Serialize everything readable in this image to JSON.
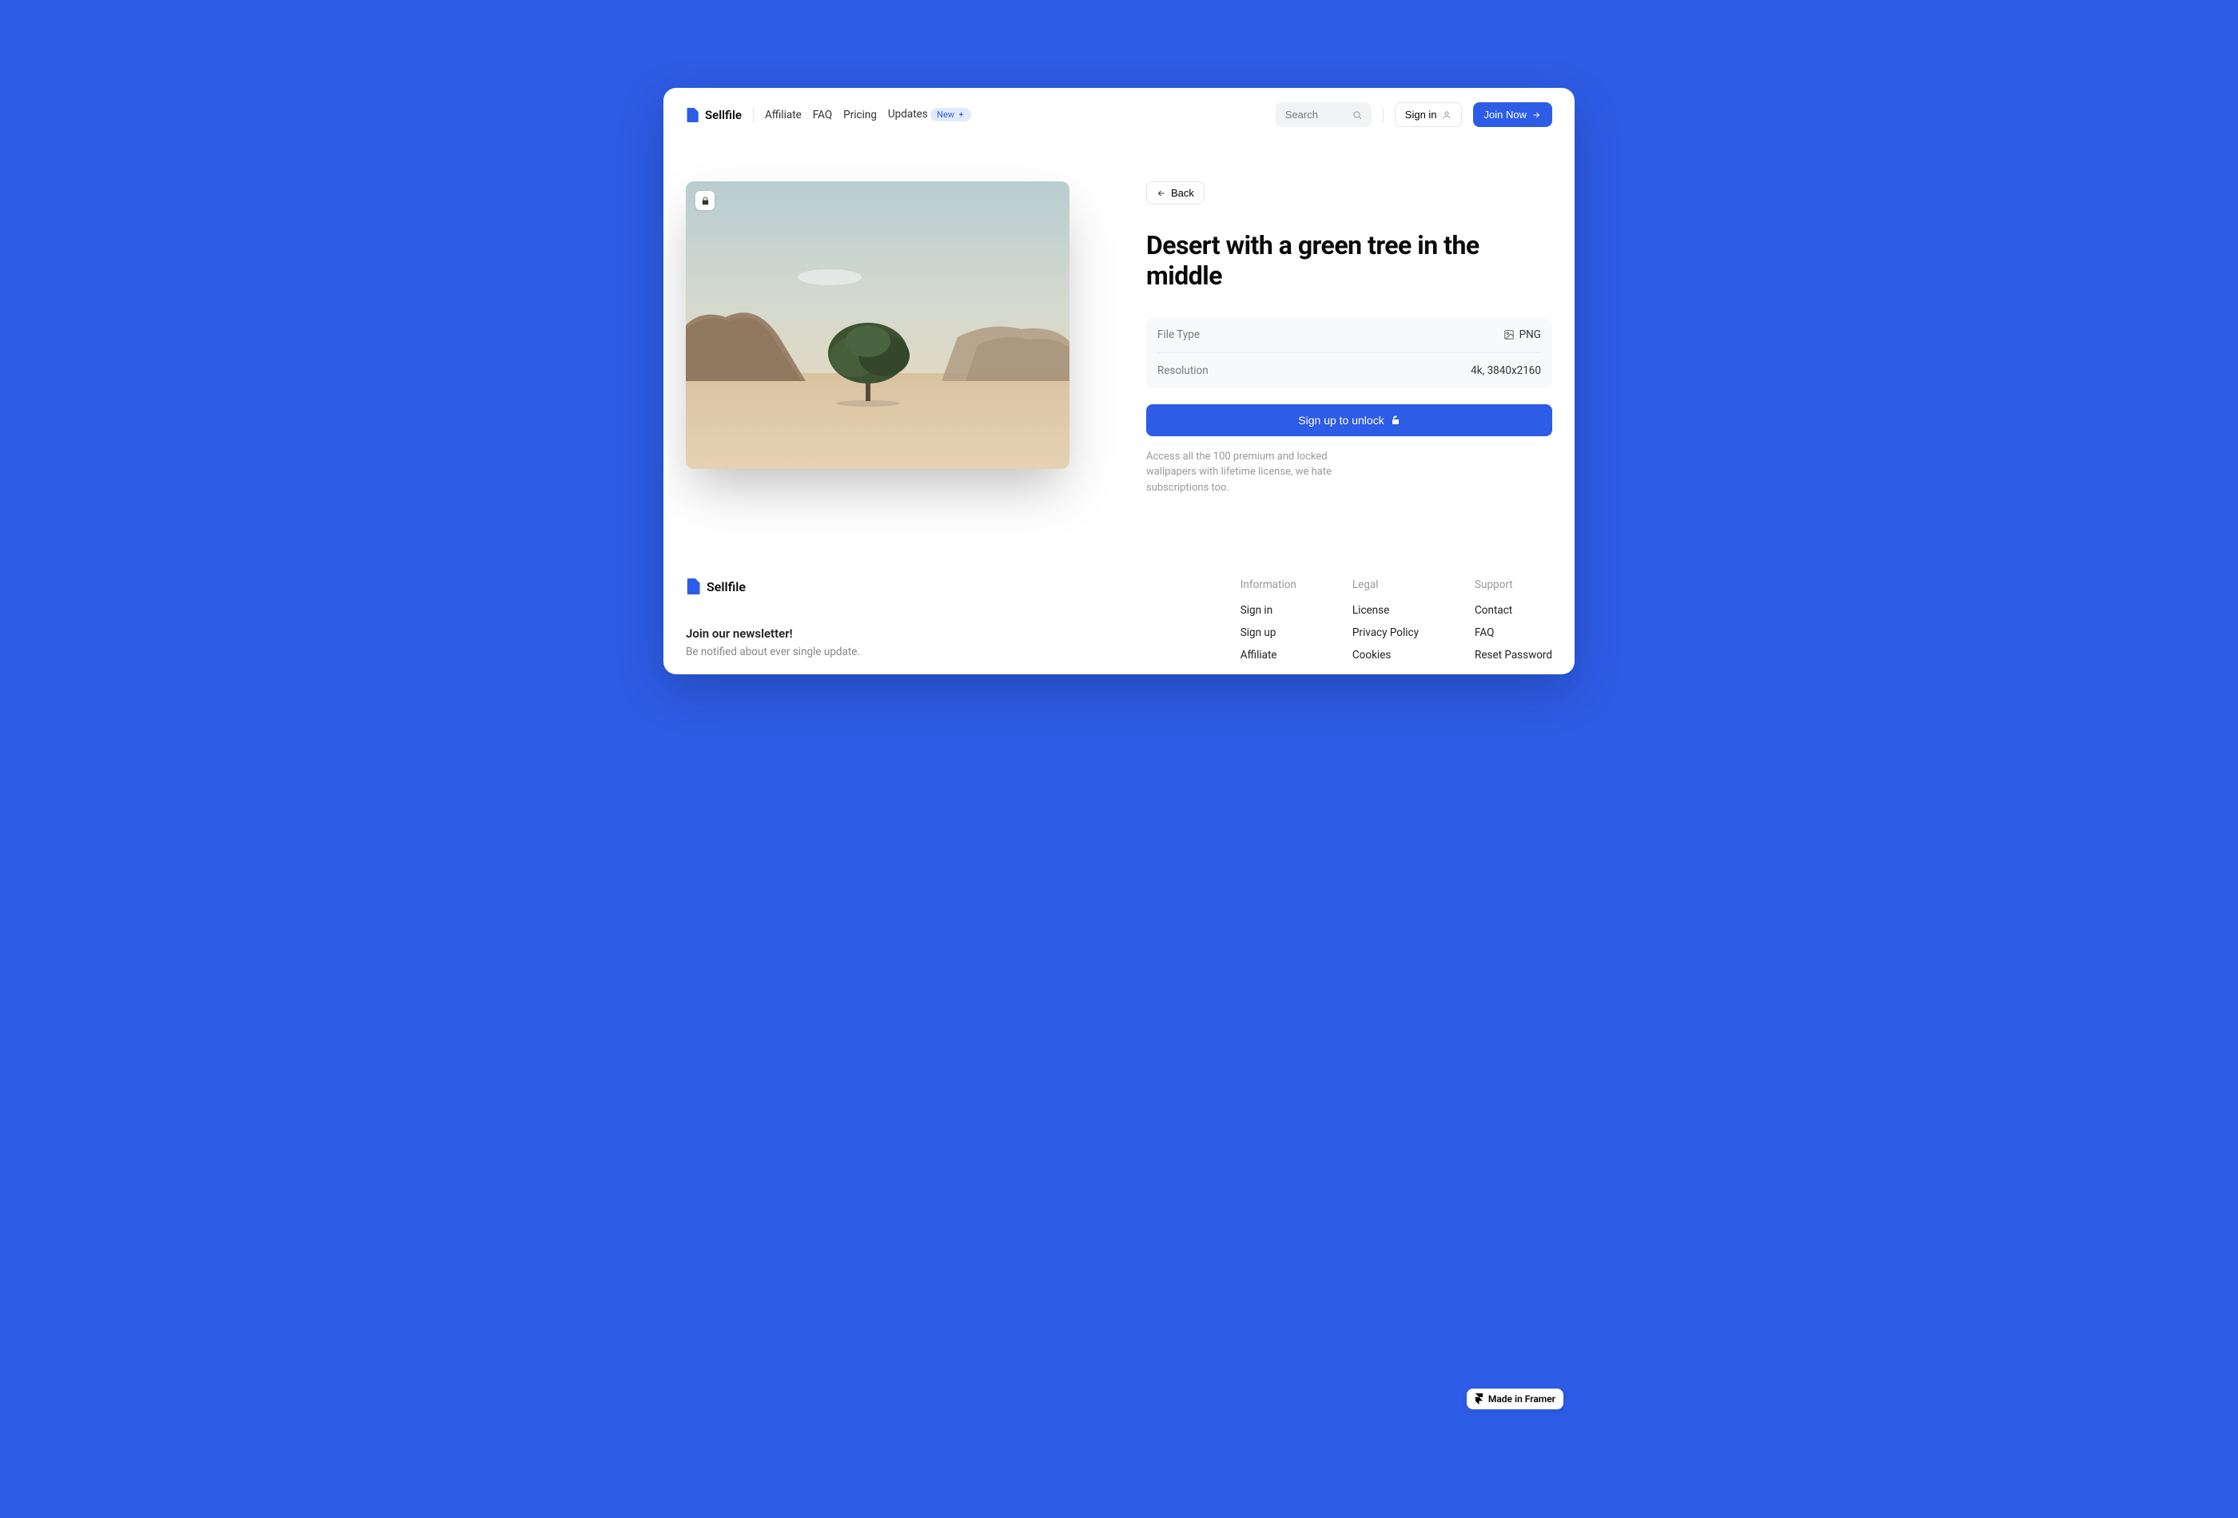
{
  "brand": {
    "name": "Sellfile"
  },
  "nav": {
    "items": [
      "Affiliate",
      "FAQ",
      "Pricing",
      "Updates"
    ],
    "badge": "New"
  },
  "search": {
    "placeholder": "Search"
  },
  "auth": {
    "signin": "Sign in",
    "join": "Join Now"
  },
  "product": {
    "back": "Back",
    "title": "Desert with a green tree in the middle",
    "meta": {
      "file_type_label": "File Type",
      "file_type_value": "PNG",
      "resolution_label": "Resolution",
      "resolution_value": "4k, 3840x2160"
    },
    "unlock_label": "Sign up to unlock",
    "helper": "Access all the 100 premium and locked wallpapers with lifetime license, we hate subscriptions too."
  },
  "footer": {
    "newsletter": {
      "title": "Join our newsletter!",
      "sub": "Be notified about ever single update."
    },
    "columns": [
      {
        "title": "Information",
        "links": [
          "Sign in",
          "Sign up",
          "Affiliate"
        ]
      },
      {
        "title": "Legal",
        "links": [
          "License",
          "Privacy Policy",
          "Cookies"
        ]
      },
      {
        "title": "Support",
        "links": [
          "Contact",
          "FAQ",
          "Reset Password"
        ]
      }
    ]
  },
  "framer": {
    "label": "Made in Framer"
  }
}
